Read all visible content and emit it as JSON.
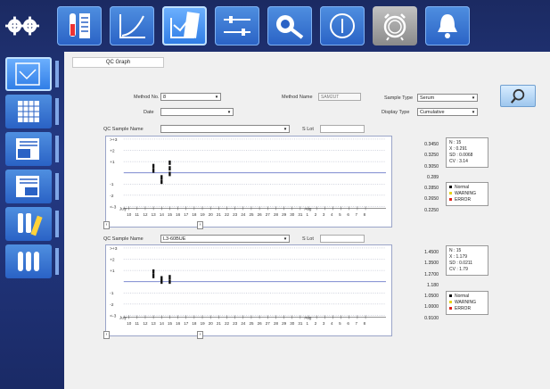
{
  "toolbar": {
    "items": [
      {
        "icon": "gear-settings-icon",
        "style": "plain"
      },
      {
        "icon": "tube-list-icon",
        "style": "blue"
      },
      {
        "icon": "calibration-curve-icon",
        "style": "blue"
      },
      {
        "icon": "qc-graph-icon",
        "style": "active"
      },
      {
        "icon": "connection-icon",
        "style": "blue"
      },
      {
        "icon": "maintenance-icon",
        "style": "blue"
      },
      {
        "icon": "power-icon",
        "style": "blue"
      },
      {
        "icon": "alarm-clock-icon",
        "style": "gray"
      },
      {
        "icon": "bell-icon",
        "style": "blue"
      }
    ]
  },
  "sidebar": {
    "items": [
      {
        "icon": "qc-graph-icon",
        "active": true
      },
      {
        "icon": "grid-table-icon",
        "active": false
      },
      {
        "icon": "qc-calendar-list-icon",
        "active": false
      },
      {
        "icon": "qc-list-icon",
        "active": false
      },
      {
        "icon": "reagent-tubes-icon",
        "active": false
      },
      {
        "icon": "tube-rack-icon",
        "active": false
      }
    ]
  },
  "header": {
    "title": "QC Graph"
  },
  "filters": {
    "method_no_label": "Method No.",
    "method_no_value": "8",
    "method_name_label": "Method Name",
    "method_name_value": "SAM2UT",
    "sample_type_label": "Sample Type",
    "sample_type_value": "Serum",
    "date_label": "Date",
    "date_value": "",
    "display_type_label": "Display Type",
    "display_type_value": "Cumulative"
  },
  "graphs": [
    {
      "sample_name_label": "QC Sample Name",
      "sample_name_value": "",
      "slot_label": "S Lot",
      "slot_value": "",
      "y_labels": [
        ">+3",
        "+2",
        "+1",
        "",
        "-1",
        "-2",
        "<-3"
      ],
      "right_values": [
        "0.3450",
        "0.3250",
        "0.3050",
        "0.289",
        "0.2850",
        "0.2650",
        "0.2250"
      ],
      "stats": {
        "n": "N : 15",
        "x": "X : 0.291",
        "sd": "SD : 0.0068",
        "cv": "CV : 3.14"
      },
      "legend": [
        "Normal",
        "WARNING",
        "ERROR"
      ],
      "chart_data": {
        "type": "scatter",
        "x_month_labels": [
          "July",
          "Aug"
        ],
        "x_ticks": [
          "10",
          "11",
          "12",
          "13",
          "14",
          "15",
          "16",
          "17",
          "18",
          "19",
          "20",
          "21",
          "22",
          "23",
          "24",
          "25",
          "26",
          "27",
          "28",
          "29",
          "30",
          "31",
          "1",
          "2",
          "3",
          "4",
          "5",
          "6",
          "7",
          "8"
        ],
        "points": [
          {
            "day": "13",
            "sd": 0.6
          },
          {
            "day": "13",
            "sd": 0.2
          },
          {
            "day": "14",
            "sd": -0.4
          },
          {
            "day": "14",
            "sd": -0.8
          },
          {
            "day": "15",
            "sd": 0.9
          },
          {
            "day": "15",
            "sd": 0.4
          },
          {
            "day": "15",
            "sd": -0.1
          }
        ]
      }
    },
    {
      "sample_name_label": "QC Sample Name",
      "sample_name_value": "L3-60BUE",
      "slot_label": "S Lot",
      "slot_value": "",
      "y_labels": [
        ">+3",
        "+2",
        "+1",
        "",
        "-1",
        "-2",
        "<-3"
      ],
      "right_values": [
        "1.4500",
        "1.3500",
        "1.2700",
        "1.180",
        "1.0500",
        "1.0000",
        "0.9100"
      ],
      "stats": {
        "n": "N : 15",
        "x": "X : 1.179",
        "sd": "SD : 0.0211",
        "cv": "CV : 1.79"
      },
      "legend": [
        "Normal",
        "WARNING",
        "ERROR"
      ],
      "chart_data": {
        "type": "scatter",
        "x_month_labels": [
          "July",
          "Aug"
        ],
        "x_ticks": [
          "10",
          "11",
          "12",
          "13",
          "14",
          "15",
          "16",
          "17",
          "18",
          "19",
          "20",
          "21",
          "22",
          "23",
          "24",
          "25",
          "26",
          "27",
          "28",
          "29",
          "30",
          "31",
          "1",
          "2",
          "3",
          "4",
          "5",
          "6",
          "7",
          "8"
        ],
        "points": [
          {
            "day": "13",
            "sd": 0.9
          },
          {
            "day": "13",
            "sd": 0.5
          },
          {
            "day": "14",
            "sd": 0.3
          },
          {
            "day": "14",
            "sd": 0.0
          },
          {
            "day": "15",
            "sd": 0.4
          },
          {
            "day": "15",
            "sd": 0.0
          }
        ]
      }
    }
  ],
  "colors": {
    "normal": "#111111",
    "warning": "#e7d51c",
    "error": "#e0241c",
    "gridline": "#6a78c8"
  }
}
